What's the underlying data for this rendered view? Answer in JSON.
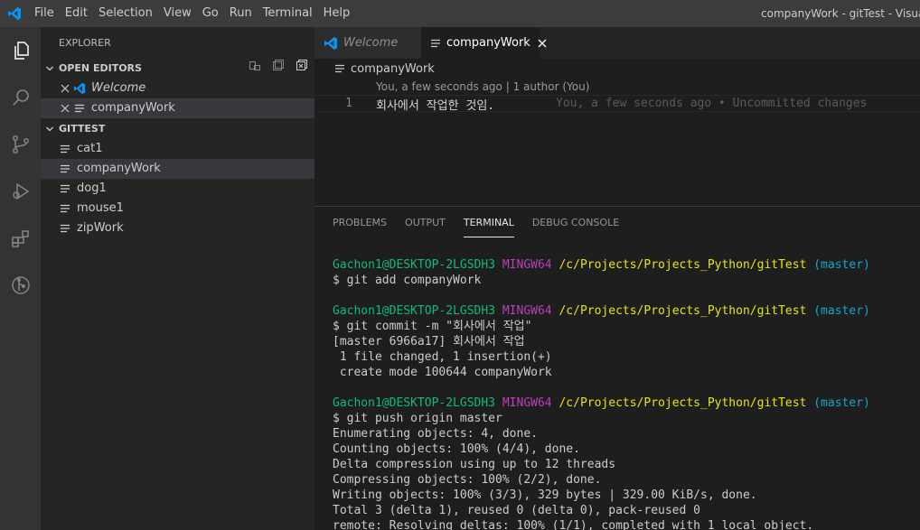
{
  "app": {
    "title": "companyWork - gitTest - Visual Studio Code",
    "menu": [
      "File",
      "Edit",
      "Selection",
      "View",
      "Go",
      "Run",
      "Terminal",
      "Help"
    ]
  },
  "activity_bar": [
    "explorer-icon",
    "search-icon",
    "source-control-icon",
    "run-debug-icon",
    "extensions-icon",
    "git-graph-icon"
  ],
  "sidebar": {
    "title": "EXPLORER",
    "open_editors": {
      "header": "OPEN EDITORS",
      "items": [
        {
          "label": "Welcome"
        },
        {
          "label": "companyWork"
        }
      ]
    },
    "folder": {
      "header": "GITTEST",
      "files": [
        "cat1",
        "companyWork",
        "dog1",
        "mouse1",
        "zipWork"
      ]
    }
  },
  "tabs": [
    {
      "label": "Welcome"
    },
    {
      "label": "companyWork"
    }
  ],
  "breadcrumb": "companyWork",
  "editor": {
    "codelens": "You, a few seconds ago | 1 author (You)",
    "line_number": "1",
    "line_text": "회사에서 작업한 것임.",
    "blame": "You, a few seconds ago • Uncommitted changes"
  },
  "panel": {
    "tabs": [
      "PROBLEMS",
      "OUTPUT",
      "TERMINAL",
      "DEBUG CONSOLE"
    ],
    "active_tab": "TERMINAL",
    "prompt": {
      "user": "Gachon1@DESKTOP-2LGSDH3",
      "shell": "MINGW64",
      "path": "/c/Projects/Projects_Python/gitTest",
      "branch": "(master)"
    },
    "lines": {
      "cmd1": "$ git add companyWork",
      "cmd2": "$ git commit -m \"회사에서 작업\"",
      "out2a": "[master 6966a17] 회사에서 작업",
      "out2b": " 1 file changed, 1 insertion(+)",
      "out2c": " create mode 100644 companyWork",
      "cmd3": "$ git push origin master",
      "out3a": "Enumerating objects: 4, done.",
      "out3b": "Counting objects: 100% (4/4), done.",
      "out3c": "Delta compression using up to 12 threads",
      "out3d": "Compressing objects: 100% (2/2), done.",
      "out3e": "Writing objects: 100% (3/3), 329 bytes | 329.00 KiB/s, done.",
      "out3f": "Total 3 (delta 1), reused 0 (delta 0), pack-reused 0",
      "out3g": "remote: Resolving deltas: 100% (1/1), completed with 1 local object."
    }
  },
  "colors": {
    "vscode_blue": "#0098ff",
    "prompt_green": "#0dbc79",
    "prompt_magenta": "#bc3fbc",
    "prompt_yellow": "#e5e510",
    "prompt_cyan": "#11a8cd"
  }
}
